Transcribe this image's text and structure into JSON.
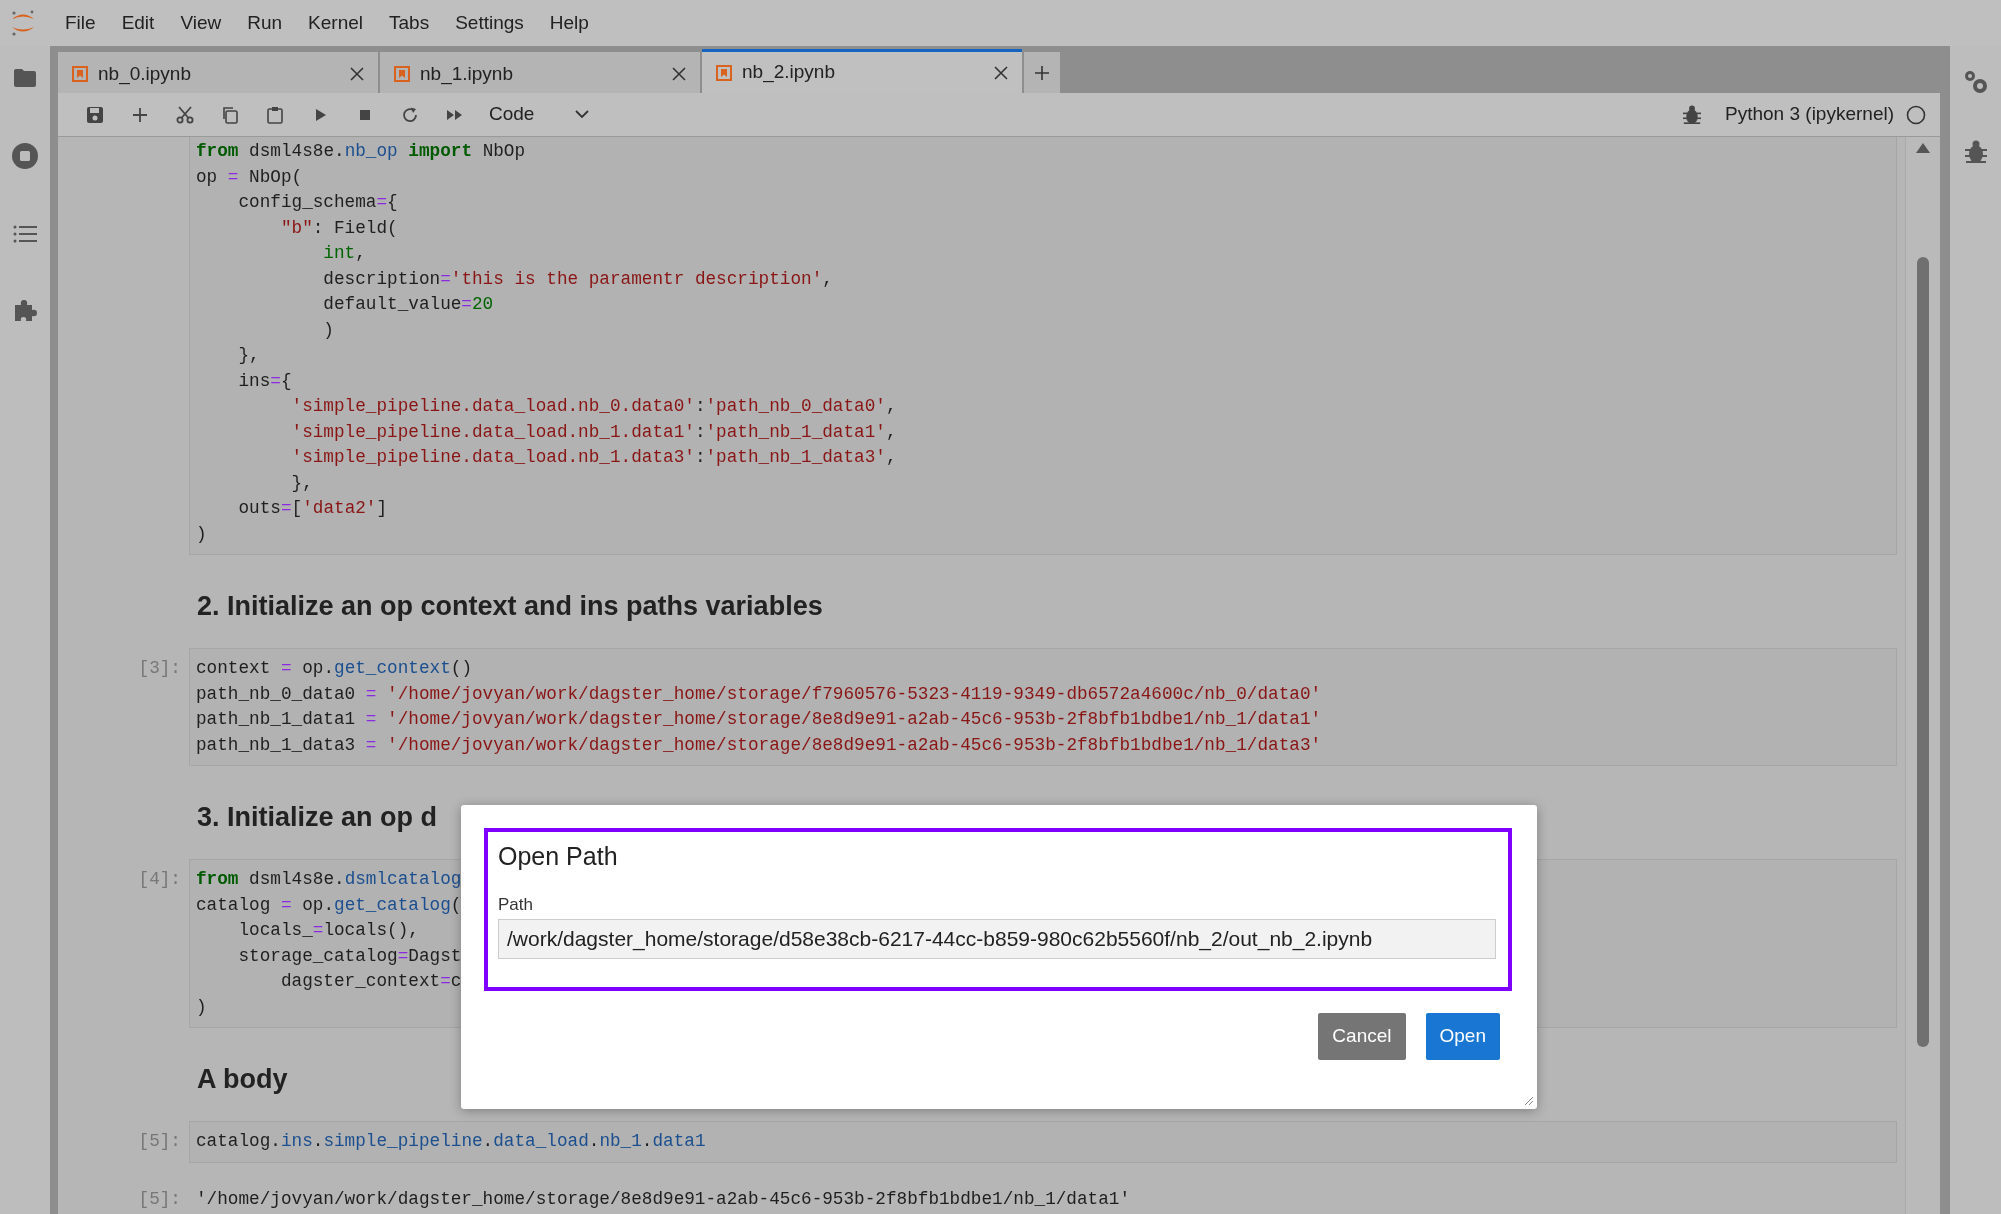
{
  "menu": [
    "File",
    "Edit",
    "View",
    "Run",
    "Kernel",
    "Tabs",
    "Settings",
    "Help"
  ],
  "tabs": [
    {
      "label": "nb_0.ipynb",
      "selected": false
    },
    {
      "label": "nb_1.ipynb",
      "selected": false
    },
    {
      "label": "nb_2.ipynb",
      "selected": true
    }
  ],
  "toolbar": {
    "cell_type": "Code",
    "kernel": "Python 3 (ipykernel)",
    "kernel_busy": false
  },
  "cells": [
    {
      "kind": "code",
      "lines": [
        [
          {
            "text": "from",
            "kind": "keyword"
          },
          {
            "text": " dsml4s8e.",
            "kind": "plain"
          },
          {
            "text": "nb_op",
            "kind": "attribute"
          },
          {
            "text": " import",
            "kind": "keyword"
          },
          {
            "text": " NbOp",
            "kind": "plain"
          }
        ],
        [
          {
            "text": "op ",
            "kind": "plain"
          },
          {
            "text": "=",
            "kind": "operator"
          },
          {
            "text": " NbOp(",
            "kind": "plain"
          }
        ],
        [
          {
            "text": "    config_schema",
            "kind": "plain"
          },
          {
            "text": "=",
            "kind": "operator"
          },
          {
            "text": "{",
            "kind": "plain"
          }
        ],
        [
          {
            "text": "        \"b\"",
            "kind": "string"
          },
          {
            "text": ": Field(",
            "kind": "plain"
          }
        ],
        [
          {
            "text": "            int",
            "kind": "number"
          },
          {
            "text": ",",
            "kind": "plain"
          }
        ],
        [
          {
            "text": "            description",
            "kind": "plain"
          },
          {
            "text": "=",
            "kind": "operator"
          },
          {
            "text": "'this is the paramentr description'",
            "kind": "string"
          },
          {
            "text": ",",
            "kind": "plain"
          }
        ],
        [
          {
            "text": "            default_value",
            "kind": "plain"
          },
          {
            "text": "=",
            "kind": "operator"
          },
          {
            "text": "20",
            "kind": "number"
          }
        ],
        [
          {
            "text": "            )",
            "kind": "plain"
          }
        ],
        [
          {
            "text": "    },",
            "kind": "plain"
          }
        ],
        [
          {
            "text": "    ins",
            "kind": "plain"
          },
          {
            "text": "=",
            "kind": "operator"
          },
          {
            "text": "{",
            "kind": "plain"
          }
        ],
        [
          {
            "text": "         'simple_pipeline.data_load.nb_0.data0'",
            "kind": "string"
          },
          {
            "text": ":",
            "kind": "plain"
          },
          {
            "text": "'path_nb_0_data0'",
            "kind": "string"
          },
          {
            "text": ",",
            "kind": "plain"
          }
        ],
        [
          {
            "text": "         'simple_pipeline.data_load.nb_1.data1'",
            "kind": "string"
          },
          {
            "text": ":",
            "kind": "plain"
          },
          {
            "text": "'path_nb_1_data1'",
            "kind": "string"
          },
          {
            "text": ",",
            "kind": "plain"
          }
        ],
        [
          {
            "text": "         'simple_pipeline.data_load.nb_1.data3'",
            "kind": "string"
          },
          {
            "text": ":",
            "kind": "plain"
          },
          {
            "text": "'path_nb_1_data3'",
            "kind": "string"
          },
          {
            "text": ",",
            "kind": "plain"
          }
        ],
        [
          {
            "text": "         },",
            "kind": "plain"
          }
        ],
        [
          {
            "text": "    outs",
            "kind": "plain"
          },
          {
            "text": "=",
            "kind": "operator"
          },
          {
            "text": "[",
            "kind": "plain"
          },
          {
            "text": "'data2'",
            "kind": "string"
          },
          {
            "text": "]",
            "kind": "plain"
          }
        ],
        [
          {
            "text": ")",
            "kind": "plain"
          }
        ]
      ]
    },
    {
      "kind": "heading",
      "text": "2. Initialize an op context and ins paths variables"
    },
    {
      "kind": "code",
      "prompt": "[3]:",
      "lines": [
        [
          {
            "text": "context ",
            "kind": "plain"
          },
          {
            "text": "=",
            "kind": "operator"
          },
          {
            "text": " op.",
            "kind": "plain"
          },
          {
            "text": "get_context",
            "kind": "attribute"
          },
          {
            "text": "()",
            "kind": "plain"
          }
        ],
        [
          {
            "text": "path_nb_0_data0 ",
            "kind": "plain"
          },
          {
            "text": "=",
            "kind": "operator"
          },
          {
            "text": " '/home/jovyan/work/dagster_home/storage/f7960576-5323-4119-9349-db6572a4600c/nb_0/data0'",
            "kind": "string"
          }
        ],
        [
          {
            "text": "path_nb_1_data1 ",
            "kind": "plain"
          },
          {
            "text": "=",
            "kind": "operator"
          },
          {
            "text": " '/home/jovyan/work/dagster_home/storage/8e8d9e91-a2ab-45c6-953b-2f8bfb1bdbe1/nb_1/data1'",
            "kind": "string"
          }
        ],
        [
          {
            "text": "path_nb_1_data3 ",
            "kind": "plain"
          },
          {
            "text": "=",
            "kind": "operator"
          },
          {
            "text": " '/home/jovyan/work/dagster_home/storage/8e8d9e91-a2ab-45c6-953b-2f8bfb1bdbe1/nb_1/data3'",
            "kind": "string"
          }
        ]
      ]
    },
    {
      "kind": "heading",
      "text": "3. Initialize an op d"
    },
    {
      "kind": "code",
      "prompt": "[4]:",
      "lines": [
        [
          {
            "text": "from",
            "kind": "keyword"
          },
          {
            "text": " dsml4s8e.",
            "kind": "plain"
          },
          {
            "text": "dsmlcatalog",
            "kind": "attribute"
          }
        ],
        [
          {
            "text": "catalog ",
            "kind": "plain"
          },
          {
            "text": "=",
            "kind": "operator"
          },
          {
            "text": " op.",
            "kind": "plain"
          },
          {
            "text": "get_catalog",
            "kind": "attribute"
          },
          {
            "text": "(",
            "kind": "plain"
          }
        ],
        [
          {
            "text": "    locals_",
            "kind": "plain"
          },
          {
            "text": "=",
            "kind": "operator"
          },
          {
            "text": "locals(),",
            "kind": "plain"
          }
        ],
        [
          {
            "text": "    storage_catalog",
            "kind": "plain"
          },
          {
            "text": "=",
            "kind": "operator"
          },
          {
            "text": "Dagst",
            "kind": "plain"
          }
        ],
        [
          {
            "text": "        dagster_context",
            "kind": "plain"
          },
          {
            "text": "=",
            "kind": "operator"
          },
          {
            "text": "c",
            "kind": "plain"
          }
        ],
        [
          {
            "text": ")",
            "kind": "plain"
          }
        ]
      ]
    },
    {
      "kind": "heading",
      "text": "A body"
    },
    {
      "kind": "code",
      "prompt": "[5]:",
      "lines": [
        [
          {
            "text": "catalog.",
            "kind": "plain"
          },
          {
            "text": "ins",
            "kind": "attribute"
          },
          {
            "text": ".",
            "kind": "plain"
          },
          {
            "text": "simple_pipeline",
            "kind": "attribute"
          },
          {
            "text": ".",
            "kind": "plain"
          },
          {
            "text": "data_load",
            "kind": "attribute"
          },
          {
            "text": ".",
            "kind": "plain"
          },
          {
            "text": "nb_1",
            "kind": "attribute"
          },
          {
            "text": ".",
            "kind": "plain"
          },
          {
            "text": "data1",
            "kind": "attribute"
          }
        ]
      ]
    },
    {
      "kind": "output",
      "prompt": "[5]:",
      "text": "'/home/jovyan/work/dagster_home/storage/8e8d9e91-a2ab-45c6-953b-2f8bfb1bdbe1/nb_1/data1'"
    }
  ],
  "dialog": {
    "title": "Open Path",
    "label": "Path",
    "value": "/work/dagster_home/storage/d58e38cb-6217-44cc-b859-980c62b5560f/nb_2/out_nb_2.ipynb",
    "highlighted": true,
    "buttons": [
      {
        "label": "Cancel",
        "kind": "secondary"
      },
      {
        "label": "Open",
        "kind": "primary"
      }
    ]
  }
}
